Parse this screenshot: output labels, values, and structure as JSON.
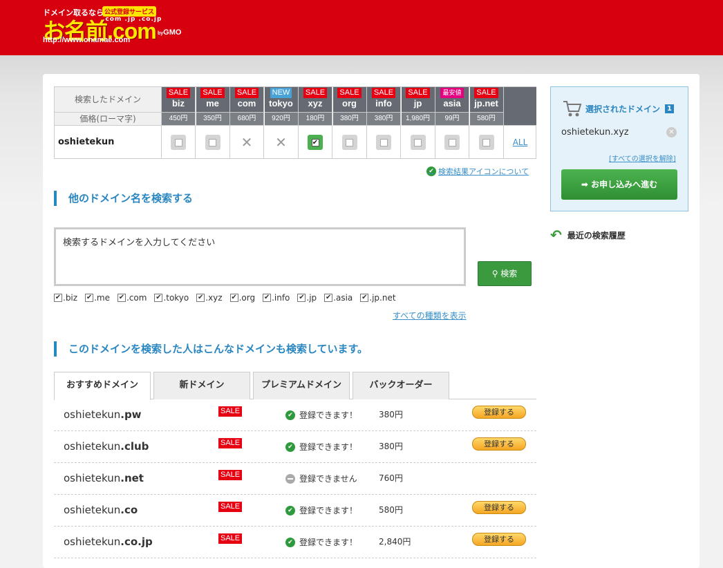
{
  "logo": {
    "tagline": "ドメイン取るなら",
    "badge": "公式登録サービス",
    "tlds": ".com .jp .co.jp",
    "name": "お名前.com",
    "by": "by",
    "gmo": "GMO",
    "url": "http://www.onamae.com"
  },
  "domain_table": {
    "label_searched": "検索したドメイン",
    "label_price": "価格(ローマ字)",
    "name": "oshietekun",
    "all_label": "ALL",
    "columns": [
      {
        "badge": "SALE",
        "badge_type": "sale",
        "tld": "biz",
        "price": "450円",
        "state": "unchecked"
      },
      {
        "badge": "SALE",
        "badge_type": "sale",
        "tld": "me",
        "price": "350円",
        "state": "unchecked"
      },
      {
        "badge": "SALE",
        "badge_type": "sale",
        "tld": "com",
        "price": "680円",
        "state": "unavailable"
      },
      {
        "badge": "NEW",
        "badge_type": "new",
        "tld": "tokyo",
        "price": "920円",
        "state": "unavailable"
      },
      {
        "badge": "SALE",
        "badge_type": "sale",
        "tld": "xyz",
        "price": "180円",
        "state": "checked"
      },
      {
        "badge": "SALE",
        "badge_type": "sale",
        "tld": "org",
        "price": "380円",
        "state": "unchecked"
      },
      {
        "badge": "SALE",
        "badge_type": "sale",
        "tld": "info",
        "price": "380円",
        "state": "unchecked"
      },
      {
        "badge": "SALE",
        "badge_type": "sale",
        "tld": "jp",
        "price": "1,980円",
        "state": "unchecked"
      },
      {
        "badge": "最安値",
        "badge_type": "best",
        "tld": "asia",
        "price": "99円",
        "state": "unchecked"
      },
      {
        "badge": "SALE",
        "badge_type": "sale",
        "tld": "jp.net",
        "price": "580円",
        "state": "unchecked"
      }
    ]
  },
  "icon_about_link": "検索結果アイコンについて",
  "section_other": "他のドメイン名を検索する",
  "search": {
    "value": "検索するドメインを入力してください",
    "button": "検索",
    "tlds": [
      ".biz",
      ".me",
      ".com",
      ".tokyo",
      ".xyz",
      ".org",
      ".info",
      ".jp",
      ".asia",
      ".jp.net"
    ],
    "show_all": "すべての種類を表示"
  },
  "section_related": "このドメインを検索した人はこんなドメインも検索しています。",
  "tabs": [
    "おすすめドメイン",
    "新ドメイン",
    "プレミアムドメイン",
    "バックオーダー"
  ],
  "results": [
    {
      "base": "oshietekun",
      "ext": ".pw",
      "sale": "SALE",
      "status": "登録できます！",
      "available": true,
      "price": "380円",
      "button": "登録する"
    },
    {
      "base": "oshietekun",
      "ext": ".club",
      "sale": "SALE",
      "status": "登録できます！",
      "available": true,
      "price": "380円",
      "button": "登録する"
    },
    {
      "base": "oshietekun",
      "ext": ".net",
      "sale": "SALE",
      "status": "登録できません",
      "available": false,
      "price": "760円",
      "button": ""
    },
    {
      "base": "oshietekun",
      "ext": ".co",
      "sale": "SALE",
      "status": "登録できます！",
      "available": true,
      "price": "580円",
      "button": "登録する"
    },
    {
      "base": "oshietekun",
      "ext": ".co.jp",
      "sale": "SALE",
      "status": "登録できます！",
      "available": true,
      "price": "2,840円",
      "button": "登録する"
    }
  ],
  "sidebar": {
    "selected_title": "選択されたドメイン",
    "count": "1",
    "selected_domain": "oshietekun.xyz",
    "clear_all": "[すべての選択を解除]",
    "proceed": "お申し込みへ進む",
    "history": "最近の検索履歴"
  },
  "colors": {
    "header": "#d7000f",
    "accent_blue": "#2a86c0",
    "green": "#3a9a3d",
    "sale_red": "#e60012"
  }
}
